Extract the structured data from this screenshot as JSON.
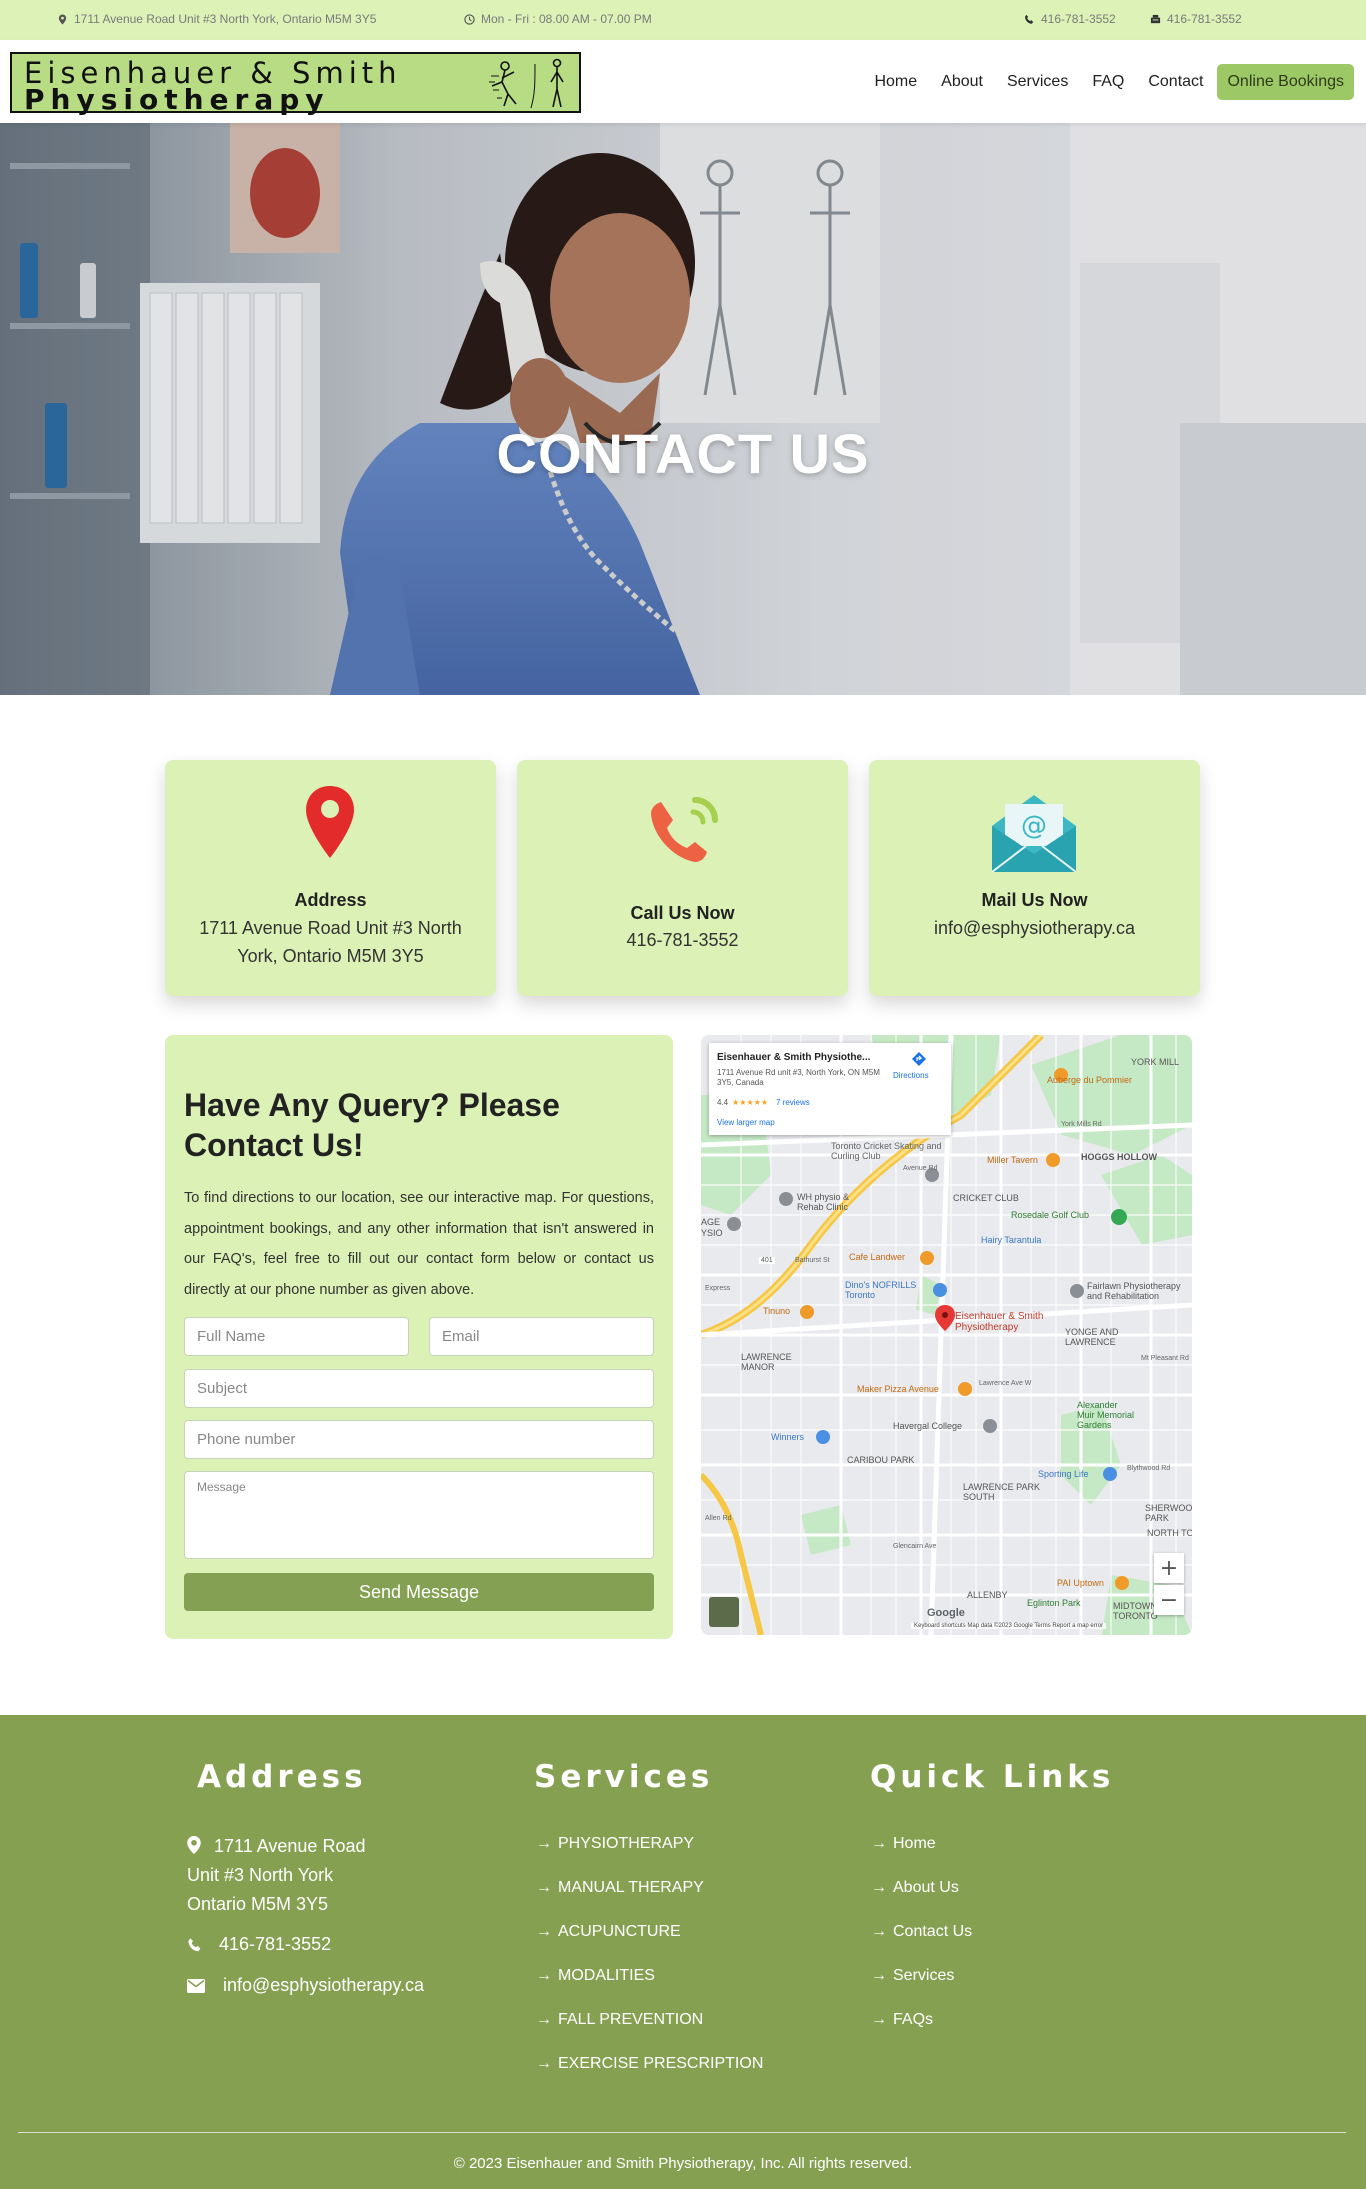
{
  "topbar": {
    "address": "1711 Avenue Road Unit #3 North York, Ontario M5M 3Y5",
    "hours": "Mon - Fri : 08.00 AM - 07.00 PM",
    "phone": "416-781-3552",
    "fax": "416-781-3552"
  },
  "brand": {
    "line1": "Eisenhauer & Smith",
    "line2": "Physiotherapy"
  },
  "nav": {
    "items": [
      "Home",
      "About",
      "Services",
      "FAQ",
      "Contact"
    ],
    "cta": "Online Bookings"
  },
  "hero": {
    "title": "CONTACT US"
  },
  "cards": [
    {
      "icon": "map-pin-icon",
      "title": "Address",
      "text": "1711 Avenue Road Unit #3 North York, Ontario M5M 3Y5"
    },
    {
      "icon": "phone-icon",
      "title": "Call Us Now",
      "text": "416-781-3552"
    },
    {
      "icon": "mail-icon",
      "title": "Mail Us Now",
      "text": "info@esphysiotherapy.ca"
    }
  ],
  "form": {
    "title": "Have Any Query? Please Contact Us!",
    "description": "To find directions to our location, see our interactive map. For questions, appointment bookings, and any other information that isn't answered in our FAQ's, feel free to fill out our contact form below or contact us directly at our phone number as given above.",
    "placeholders": {
      "name": "Full Name",
      "email": "Email",
      "subject": "Subject",
      "phone": "Phone number",
      "message": "Message"
    },
    "submit": "Send Message"
  },
  "map": {
    "place_name": "Eisenhauer & Smith Physiothe...",
    "place_address": "1711 Avenue Rd unit #3, North York, ON M5M 3Y5, Canada",
    "rating": "4.4",
    "stars": "★★★★★",
    "reviews": "7 reviews",
    "directions": "Directions",
    "larger_map": "View larger map",
    "marker_label": "Eisenhauer & Smith Physiotherapy",
    "footer": "Keyboard shortcuts   Map data ©2023 Google   Terms   Report a map error",
    "google": "Google",
    "labels": [
      "YORK MILL",
      "Auberge du Pommier",
      "York Mills Rd",
      "HOGGS HOLLOW",
      "Miller Tavern",
      "Toronto Cricket Skating and Curling Club",
      "CRICKET CLUB",
      "Rosedale Golf Club",
      "WH physio & Rehab Clinic",
      "Hairy Tarantula",
      "Cafe Landwer",
      "Dino's NOFRILLS Toronto",
      "Fairlawn Physiotherapy and Rehabilitation",
      "Tinuno",
      "YONGE AND LAWRENCE",
      "LAWRENCE MANOR",
      "Maker Pizza Avenue",
      "Lawrence Ave W",
      "Alexander Muir Memorial Gardens",
      "Winners",
      "Havergal College",
      "CARIBOU PARK",
      "Sporting Life",
      "LAWRENCE PARK SOUTH",
      "SHERWOOD PARK",
      "NORTH TORO",
      "PAI Uptown",
      "ALLENBY",
      "Eglinton Park",
      "MIDTOWN TORONTO",
      "AGE",
      "YSIO",
      "Avenue Rd",
      "Bathurst St",
      "Glencairn Ave",
      "Express",
      "401",
      "Allen Rd",
      "Mt Pleasant Rd",
      "Blythwood Rd"
    ]
  },
  "footer": {
    "address_heading": "Address",
    "address_lines": [
      "1711 Avenue Road",
      "Unit #3 North York",
      "Ontario M5M 3Y5"
    ],
    "phone": "416-781-3552",
    "email": "info@esphysiotherapy.ca",
    "services_heading": "Services",
    "services": [
      "PHYSIOTHERAPY",
      "MANUAL THERAPY",
      "ACUPUNCTURE",
      "MODALITIES",
      "FALL PREVENTION",
      "EXERCISE PRESCRIPTION"
    ],
    "links_heading": "Quick Links",
    "links": [
      "Home",
      "About Us",
      "Contact Us",
      "Services",
      "FAQs"
    ],
    "copyright": "© 2023 Eisenhauer and Smith Physiotherapy, Inc. All rights reserved."
  },
  "colors": {
    "topbar_bg": "#dcf2b7",
    "accent_green": "#9cc966",
    "card_bg": "#dbf1b5",
    "footer_bg": "#86a052",
    "button_green": "#84a052"
  }
}
